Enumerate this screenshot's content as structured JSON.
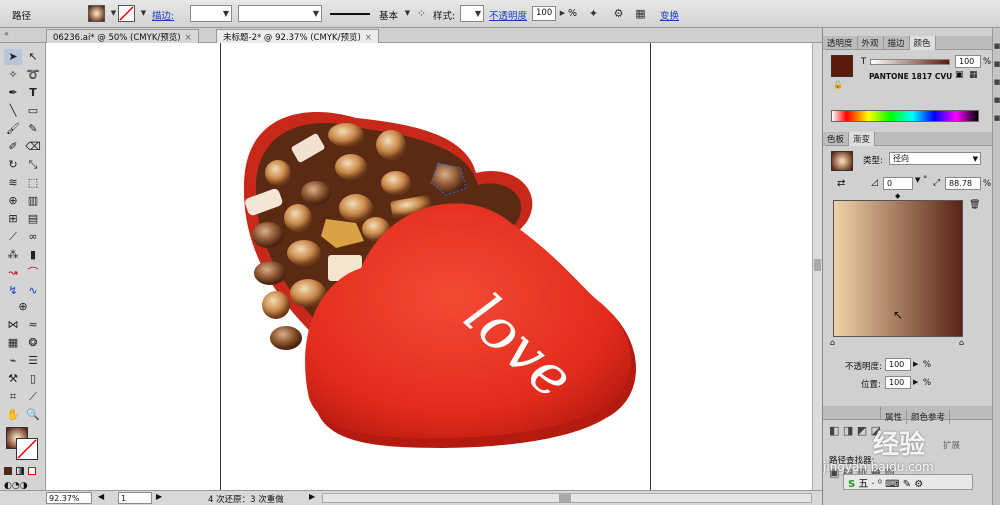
{
  "control_bar": {
    "object_type": "路径",
    "stroke_label": "描边:",
    "stroke_profile": "基本",
    "style_label": "样式:",
    "opacity_label": "不透明度",
    "opacity_value": "100",
    "percent": "%",
    "transform_label": "变换"
  },
  "tabs": [
    {
      "label": "06236.ai* @ 50% (CMYK/预览)",
      "close": "×"
    },
    {
      "label": "未标题-2* @ 92.37% (CMYK/预览)",
      "close": "×"
    }
  ],
  "artwork": {
    "word": "love",
    "colors": {
      "lid": "#e32b1c",
      "lid_dark": "#b51a10",
      "box_inner": "#5a2a12",
      "chocolate": "#c98a4b"
    }
  },
  "status_bar": {
    "zoom": "92.37%",
    "page": "1",
    "history": "4 次还原：3 次重做"
  },
  "color_panel": {
    "tabs": [
      "透明度",
      "外观",
      "描边",
      "颜色"
    ],
    "tint_label": "T",
    "tint_value": "100",
    "percent": "%",
    "swatch_name": "PANTONE 1817 CVU",
    "swatch_color": "#5b1a0c"
  },
  "gradient_panel": {
    "tabs": [
      "色板",
      "渐变"
    ],
    "type_label": "类型:",
    "type_value": "径向",
    "angle_value": "0",
    "degree": "°",
    "aspect_value": "88.78",
    "percent": "%",
    "opacity_label": "不透明度:",
    "opacity_value": "100",
    "position_label": "位置:",
    "position_value": "100",
    "start_color": "#efd2a8",
    "end_color": "#5a2316"
  },
  "lower_panel": {
    "tabs": [
      "属性",
      "颜色参考"
    ],
    "expand_label": "扩展",
    "path_finder_label": "路径查找器:"
  },
  "watermark": {
    "text": "经验",
    "url": "jingyan.baidu.com"
  }
}
